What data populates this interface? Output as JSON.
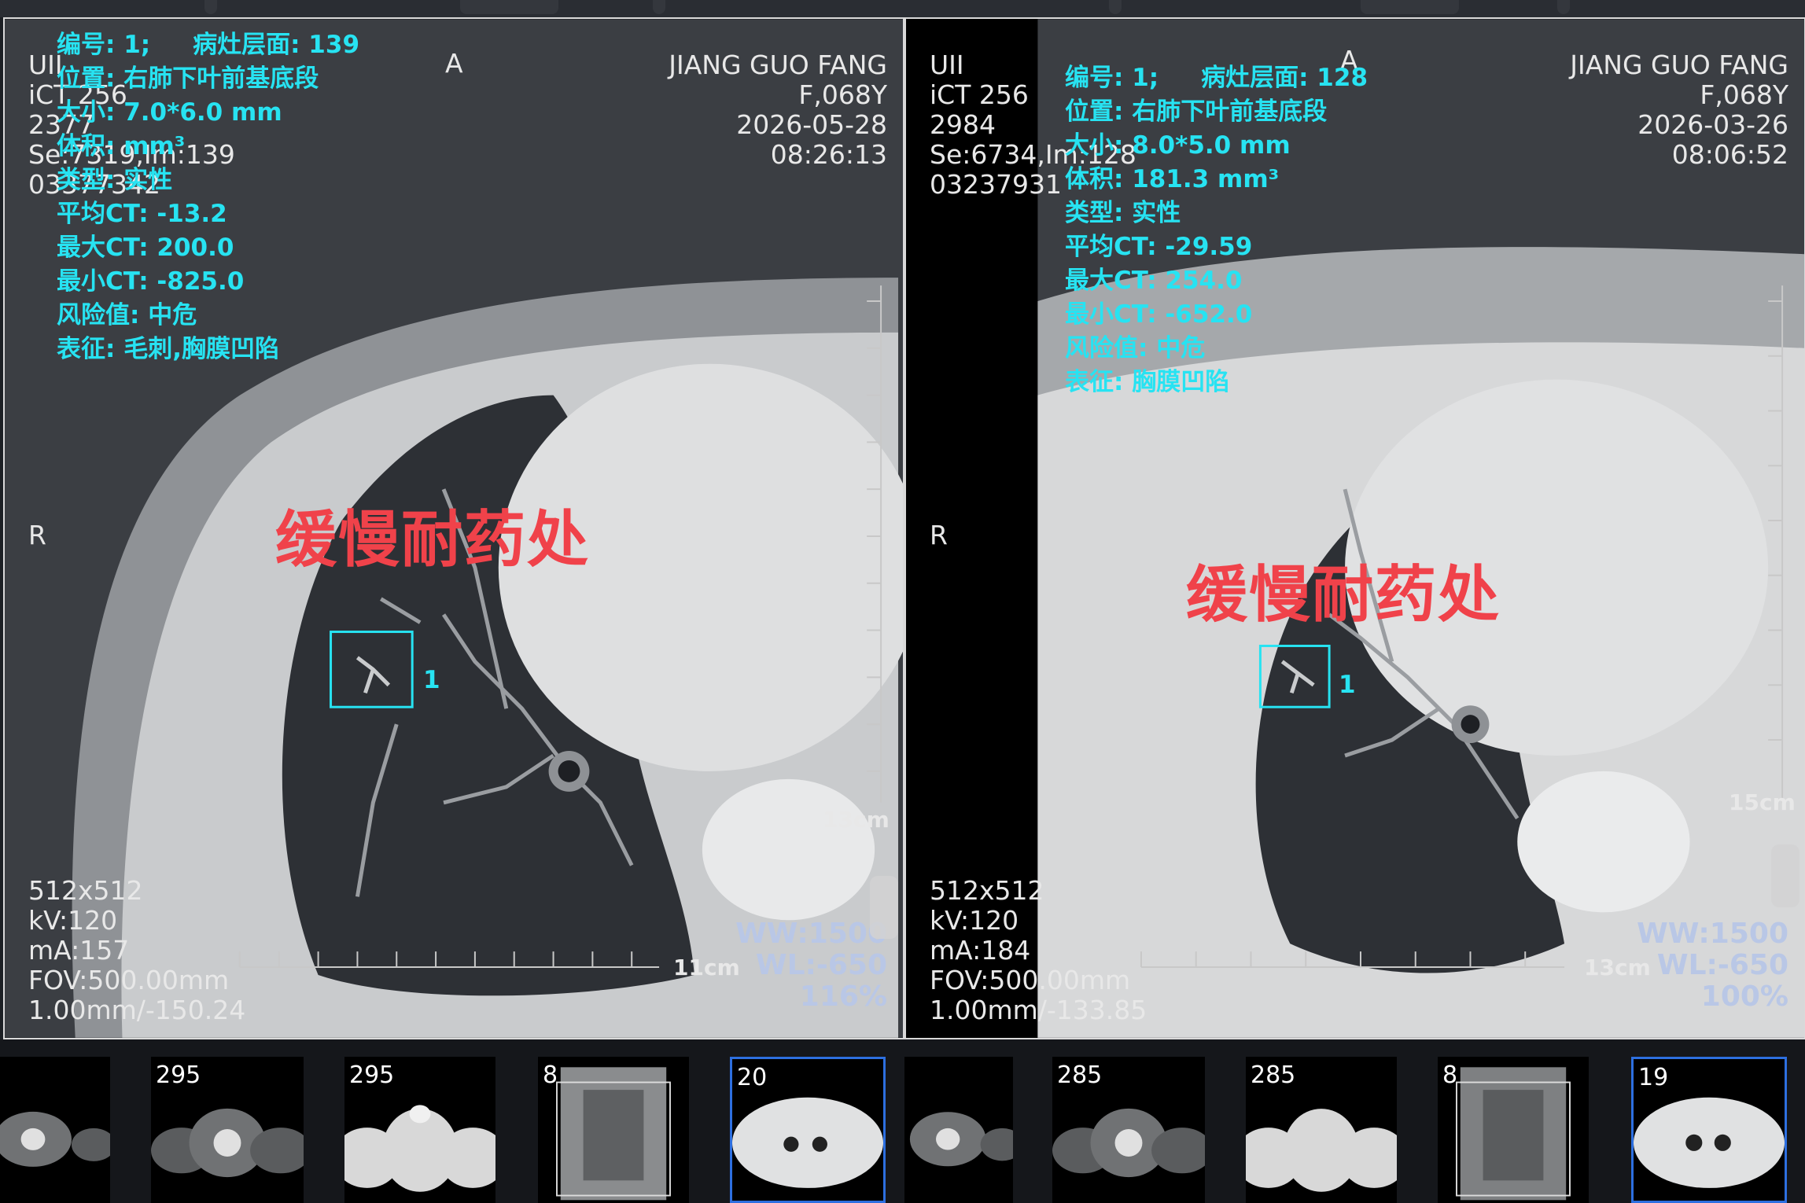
{
  "left_viewer": {
    "vendor": "UII",
    "scanner": "iCT 256",
    "study_no": "2377",
    "series_image": "Se:7319,Im:139",
    "patient_id": "03377342",
    "patient_name": "JIANG GUO FANG",
    "sex_age": "F,068Y",
    "date": "2026-05-28",
    "time": "08:26:13",
    "orientation_top": "A",
    "orientation_left": "R",
    "nodule": {
      "line1": "编号: 1;     病灶层面: 139",
      "line2": "位置: 右肺下叶前基底段",
      "line3": "大小: 7.0*6.0 mm",
      "line4": "体积: mm³",
      "line5": "类型: 实性",
      "line6": "平均CT: -13.2",
      "line7": "最大CT: 200.0",
      "line8": "最小CT: -825.0",
      "line9": "风险值: 中危",
      "line10": "表征: 毛刺,胸膜凹陷"
    },
    "annotation_label": "缓慢耐药处",
    "roi_number": "1",
    "matrix": "512x512",
    "kv": "kV:120",
    "ma": "mA:157",
    "fov": "FOV:500.00mm",
    "slice": "1.00mm/-150.24",
    "ww": "WW:1500",
    "wl": "WL:-650",
    "zoom": "116%",
    "ruler_h": "11cm",
    "ruler_v": "13cm"
  },
  "right_viewer": {
    "vendor": "UII",
    "scanner": "iCT 256",
    "study_no": "2984",
    "series_image": "Se:6734,Im:128",
    "patient_id": "03237931",
    "patient_name": "JIANG GUO FANG",
    "sex_age": "F,068Y",
    "date": "2026-03-26",
    "time": "08:06:52",
    "orientation_top": "A",
    "orientation_left": "R",
    "nodule": {
      "line1": "编号: 1;     病灶层面: 128",
      "line2": "位置: 右肺下叶前基底段",
      "line3": "大小: 8.0*5.0 mm",
      "line4": "体积: 181.3 mm³",
      "line5": "类型: 实性",
      "line6": "平均CT: -29.59",
      "line7": "最大CT: 254.0",
      "line8": "最小CT: -652.0",
      "line9": "风险值: 中危",
      "line10": "表征: 胸膜凹陷"
    },
    "annotation_label": "缓慢耐药处",
    "roi_number": "1",
    "matrix": "512x512",
    "kv": "kV:120",
    "ma": "mA:184",
    "fov": "FOV:500.00mm",
    "slice": "1.00mm/-133.85",
    "ww": "WW:1500",
    "wl": "WL:-650",
    "zoom": "100%",
    "ruler_h": "13cm",
    "ruler_v": "15cm"
  },
  "thumbnails": [
    {
      "count": "",
      "kind": "neck",
      "active": false
    },
    {
      "count": "295",
      "kind": "neck",
      "active": false
    },
    {
      "count": "295",
      "kind": "shoulder",
      "active": false
    },
    {
      "count": "8",
      "kind": "scout",
      "active": false
    },
    {
      "count": "20",
      "kind": "chest",
      "active": true
    },
    {
      "count": "",
      "kind": "neck",
      "active": false
    },
    {
      "count": "285",
      "kind": "neck",
      "active": false
    },
    {
      "count": "285",
      "kind": "shoulder",
      "active": false
    },
    {
      "count": "8",
      "kind": "scout",
      "active": false
    },
    {
      "count": "19",
      "kind": "chest",
      "active": true
    }
  ],
  "colors": {
    "overlay_cyan": "#27e3f2",
    "annotation_red": "#f0424a",
    "active_border": "#2d6fe0"
  }
}
